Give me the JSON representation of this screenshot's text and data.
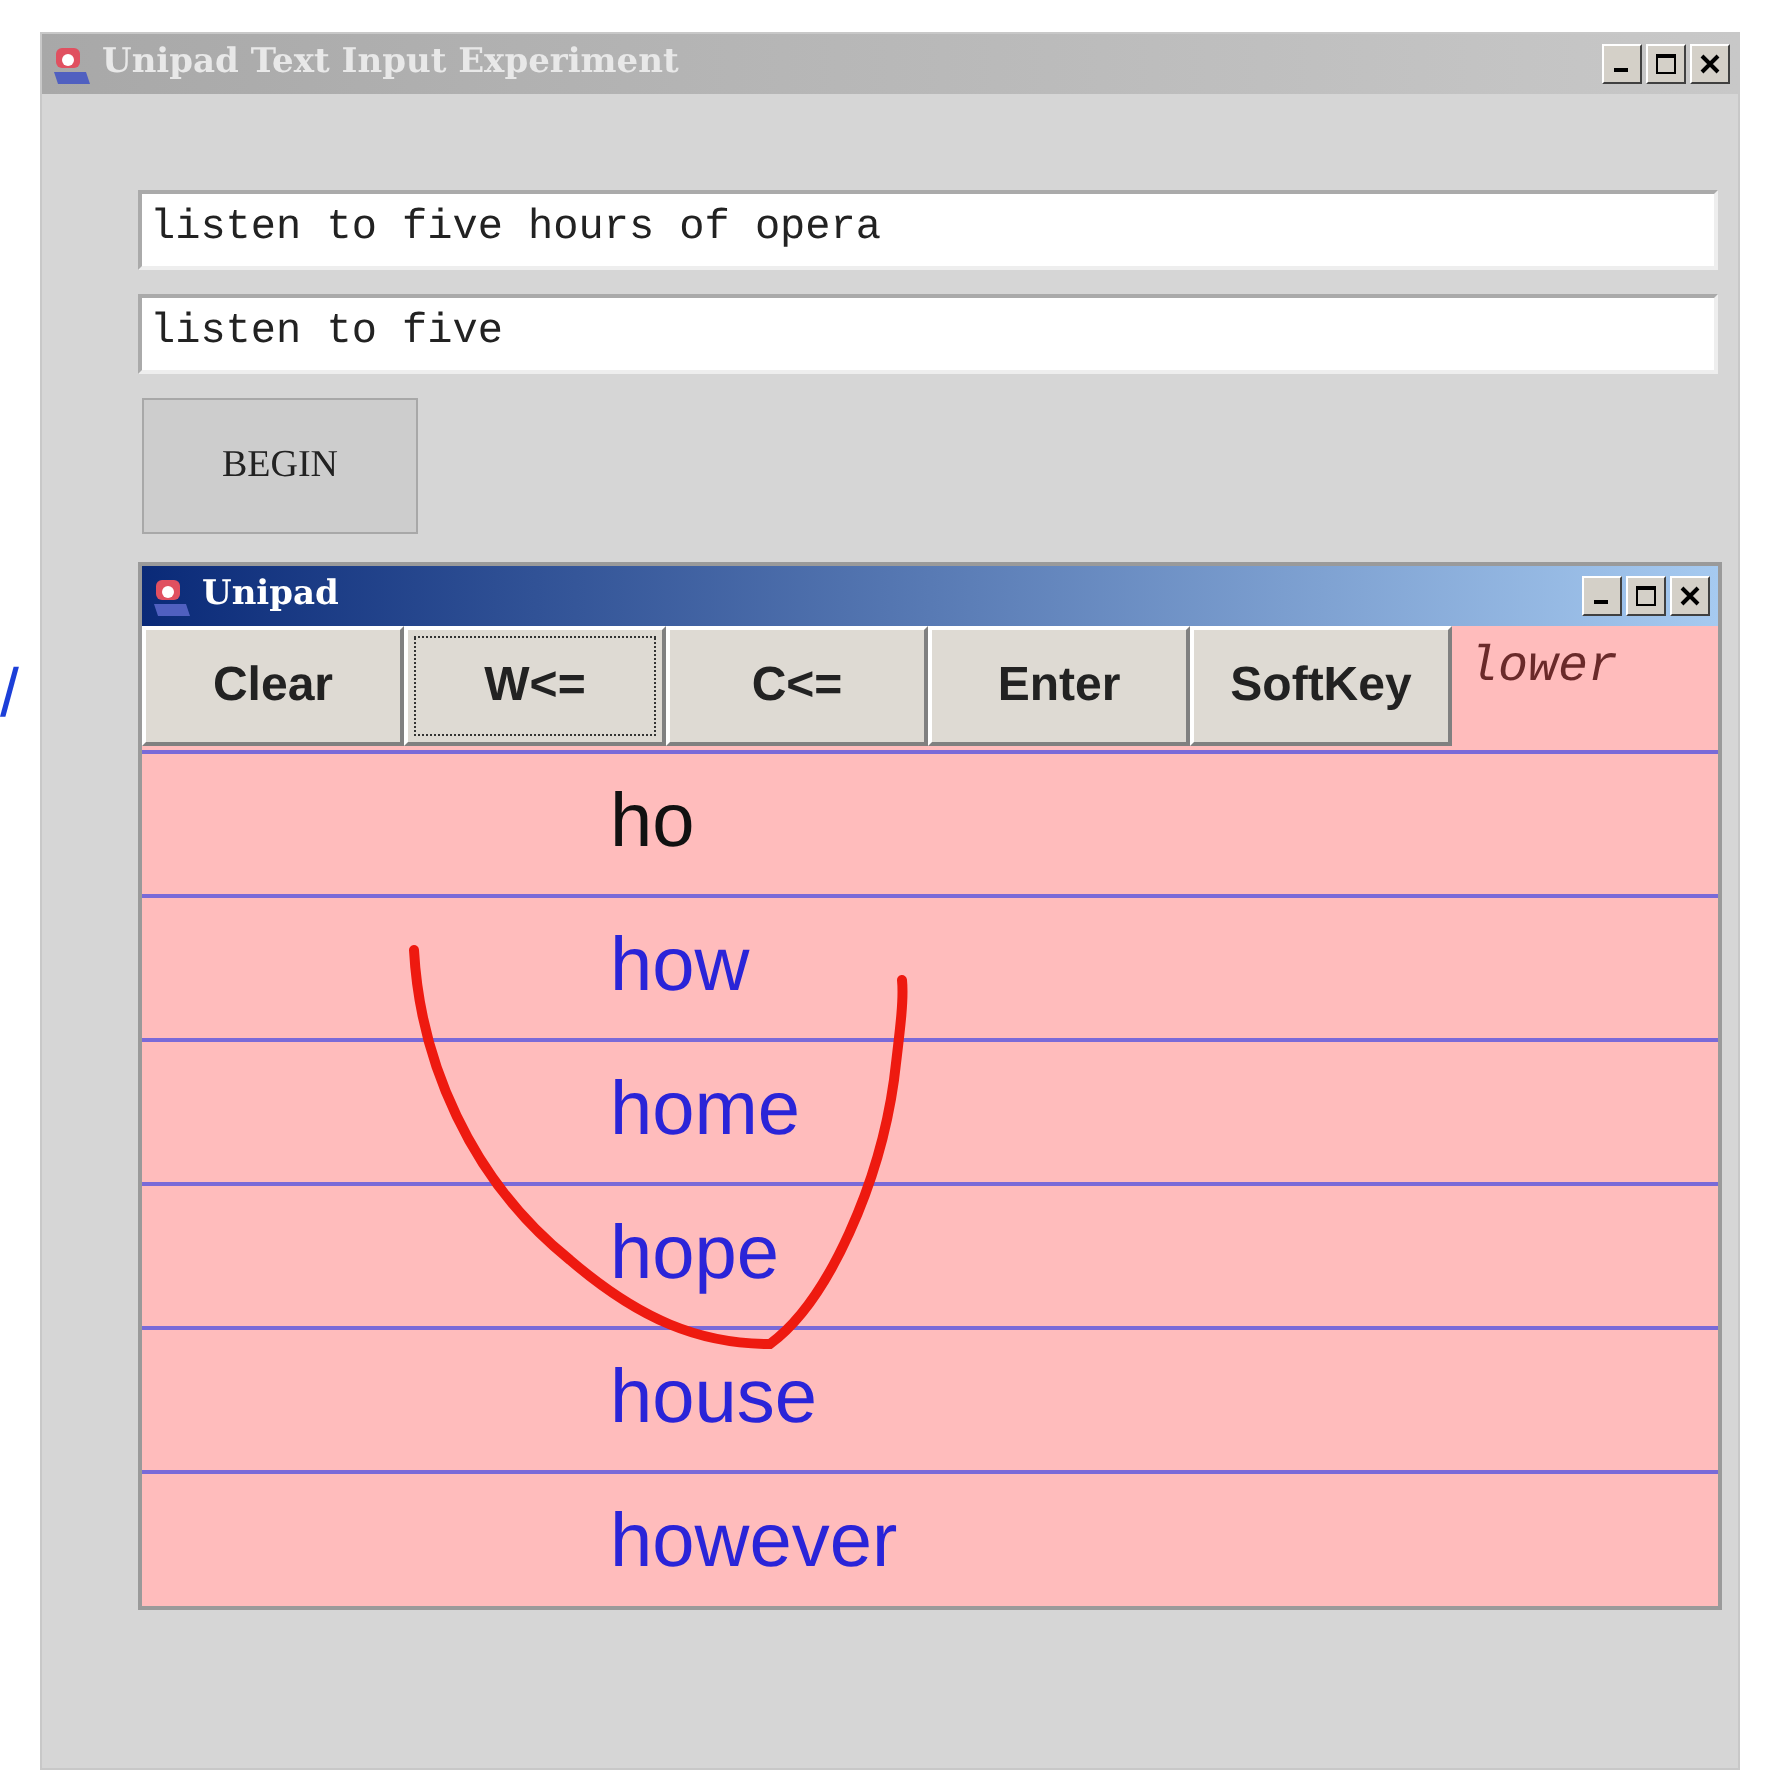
{
  "edge_fragment": "/",
  "window": {
    "title": "Unipad Text Input Experiment",
    "active": false
  },
  "fields": [
    {
      "value": "listen to five hours of opera"
    },
    {
      "value": "listen to five"
    }
  ],
  "begin_button": "BEGIN",
  "unipad": {
    "title": "Unipad",
    "active": true,
    "buttons": [
      {
        "label": "Clear",
        "focused": false
      },
      {
        "label": "W<=",
        "focused": true
      },
      {
        "label": "C<=",
        "focused": false
      },
      {
        "label": "Enter",
        "focused": false
      },
      {
        "label": "SoftKey",
        "focused": false
      }
    ],
    "case_mode": "lower",
    "rows": [
      {
        "text": "ho",
        "kind": "input"
      },
      {
        "text": "how",
        "kind": "candidate"
      },
      {
        "text": "home",
        "kind": "candidate"
      },
      {
        "text": "hope",
        "kind": "candidate"
      },
      {
        "text": "house",
        "kind": "candidate"
      },
      {
        "text": "however",
        "kind": "candidate"
      }
    ]
  }
}
